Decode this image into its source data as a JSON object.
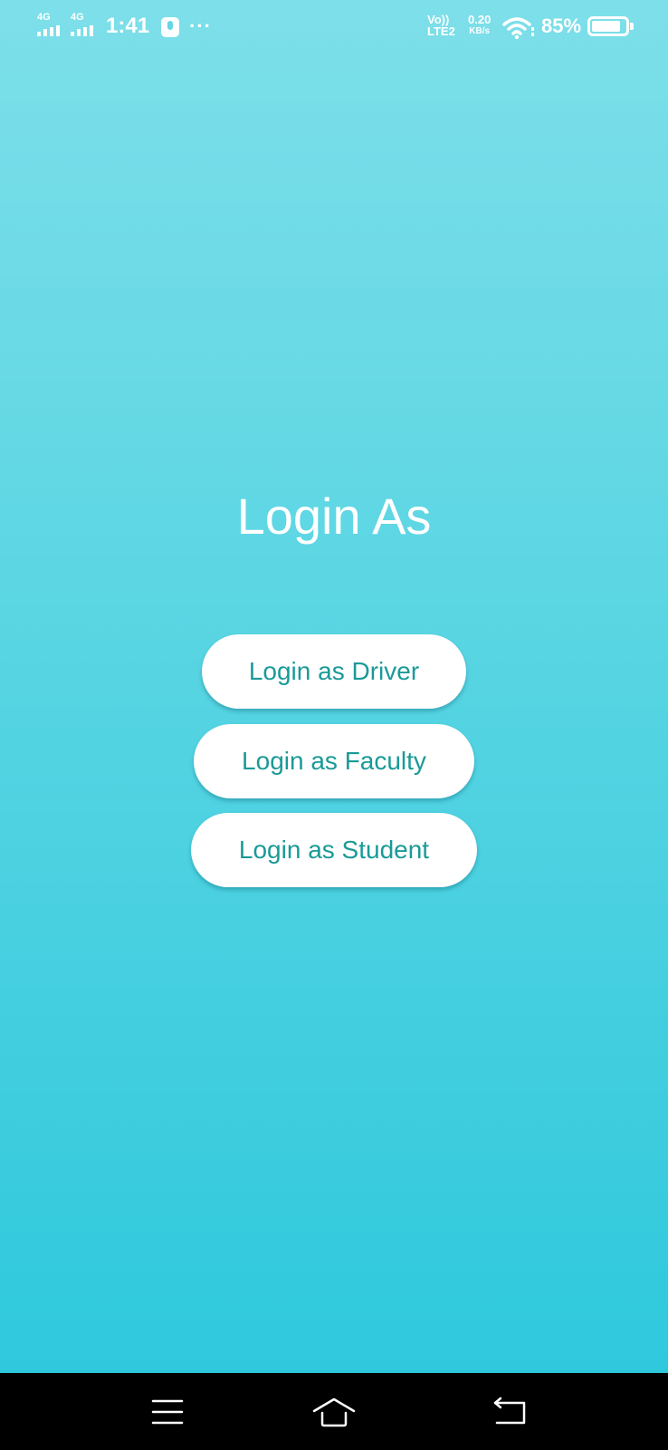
{
  "status_bar": {
    "sim1_network": "4G",
    "sim2_network": "4G",
    "time": "1:41",
    "more_indicator": "···",
    "volte_top": "Vo))",
    "volte_bottom": "LTE2",
    "speed_value": "0.20",
    "speed_unit": "KB/s",
    "battery_percent": "85%",
    "battery_level": 0.85
  },
  "main": {
    "title": "Login As",
    "buttons": {
      "driver": "Login as Driver",
      "faculty": "Login as Faculty",
      "student": "Login as Student"
    }
  },
  "nav_bar": {
    "menu_icon": "menu-icon",
    "home_icon": "home-icon",
    "back_icon": "back-icon"
  },
  "colors": {
    "background_top": "#7ddfe9",
    "background_bottom": "#2ac7dc",
    "button_text": "#1a9a98",
    "button_bg": "#ffffff",
    "title_text": "#ffffff",
    "nav_bar_bg": "#000000"
  }
}
